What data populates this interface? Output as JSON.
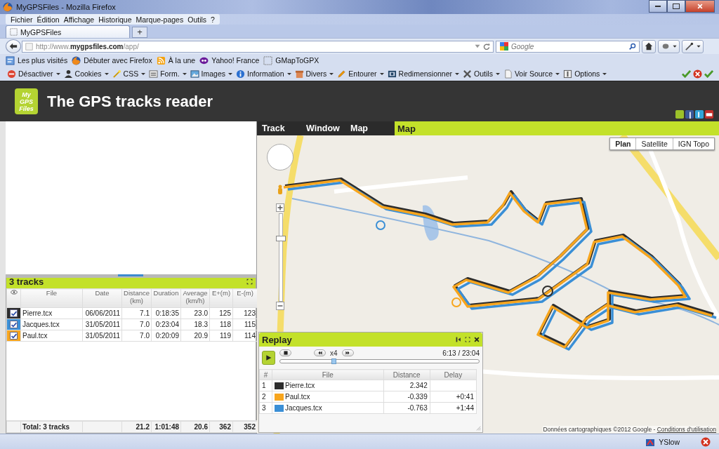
{
  "window": {
    "title": "MyGPSFiles - Mozilla Firefox"
  },
  "menu": [
    "Fichier",
    "Édition",
    "Affichage",
    "Historique",
    "Marque-pages",
    "Outils",
    "?"
  ],
  "tabs": [
    {
      "label": "MyGPSFiles",
      "selected": true
    }
  ],
  "new_tab_button": "+",
  "address_bar": {
    "url": "http://www.**mygpsfiles.com**/app/"
  },
  "search": {
    "placeholder": "Google"
  },
  "bookmarks": [
    "Les plus visités",
    "Débuter avec Firefox",
    "À la une",
    "Yahoo! France",
    "GMapToGPX"
  ],
  "dev_toolbar": [
    "Désactiver",
    "Cookies",
    "CSS",
    "Form.",
    "Images",
    "Information",
    "Divers",
    "Entourer",
    "Redimensionner",
    "Outils",
    "Voir Source",
    "Options"
  ],
  "app": {
    "logo": [
      "My",
      "GPS",
      "Files"
    ],
    "title": "The GPS tracks reader"
  },
  "app_menu": [
    "Track",
    "Window",
    "Map"
  ],
  "map_panel": {
    "title": "Map",
    "map_types": [
      {
        "label": "Plan",
        "selected": true
      },
      {
        "label": "Satellite",
        "selected": false
      },
      {
        "label": "IGN Topo",
        "selected": false
      }
    ],
    "zoom": {
      "level": 0.72
    },
    "attribution": "Données cartographiques ©2012 Google - ",
    "terms_link": "Conditions d'utilisation"
  },
  "tracks_panel": {
    "title": "3 tracks",
    "columns": [
      "File",
      "Date",
      "Distance (km)",
      "Duration",
      "Average (km/h)",
      "E+(m)",
      "E-(m)"
    ],
    "rows": [
      {
        "color": "#2d2d2d",
        "visible": true,
        "cells": [
          "Pierre.tcx",
          "06/06/2011",
          "7.1",
          "0:18:35",
          "23.0",
          "125",
          "123"
        ]
      },
      {
        "color": "#3a8fd6",
        "visible": true,
        "cells": [
          "Jacques.tcx",
          "31/05/2011",
          "7.0",
          "0:23:04",
          "18.3",
          "118",
          "115"
        ]
      },
      {
        "color": "#f7a51d",
        "visible": true,
        "cells": [
          "Paul.tcx",
          "31/05/2011",
          "7.0",
          "0:20:09",
          "20.9",
          "119",
          "114"
        ]
      }
    ],
    "total": {
      "label": "Total: 3 tracks",
      "cells": [
        "21.2",
        "1:01:48",
        "20.6",
        "362",
        "352"
      ]
    }
  },
  "replay": {
    "title": "Replay",
    "speed": "x4",
    "time": "6:13 / 23:04",
    "level": 0.27,
    "columns": [
      "#",
      "File",
      "Distance",
      "Delay"
    ],
    "rows": [
      {
        "index": "1",
        "file": "Pierre.tcx",
        "color": "#2d2d2d",
        "distance": "2.342"
      },
      {
        "index": "2",
        "file": "Paul.tcx",
        "color": "#f7a51d",
        "distance": "-0.339",
        "delay": "+0:41"
      },
      {
        "index": "3",
        "file": "Jacques.tcx",
        "color": "#3a8fd6",
        "distance": "-0.763",
        "delay": "+1:44"
      }
    ]
  },
  "status_bar": {
    "items": [
      "YSlow"
    ]
  }
}
